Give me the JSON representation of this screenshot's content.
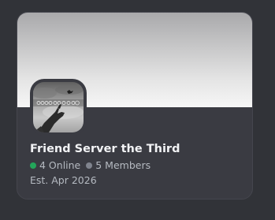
{
  "server": {
    "name": "Friend Server the Third",
    "online_count_label": "4 Online",
    "member_count_label": "5 Members",
    "established_label": "Est. Apr 2026",
    "icon": "server-photo-icon"
  },
  "colors": {
    "online_dot": "#23a55a",
    "members_dot": "#80848e",
    "card_background": "#3a3b42",
    "page_background": "#313338"
  }
}
